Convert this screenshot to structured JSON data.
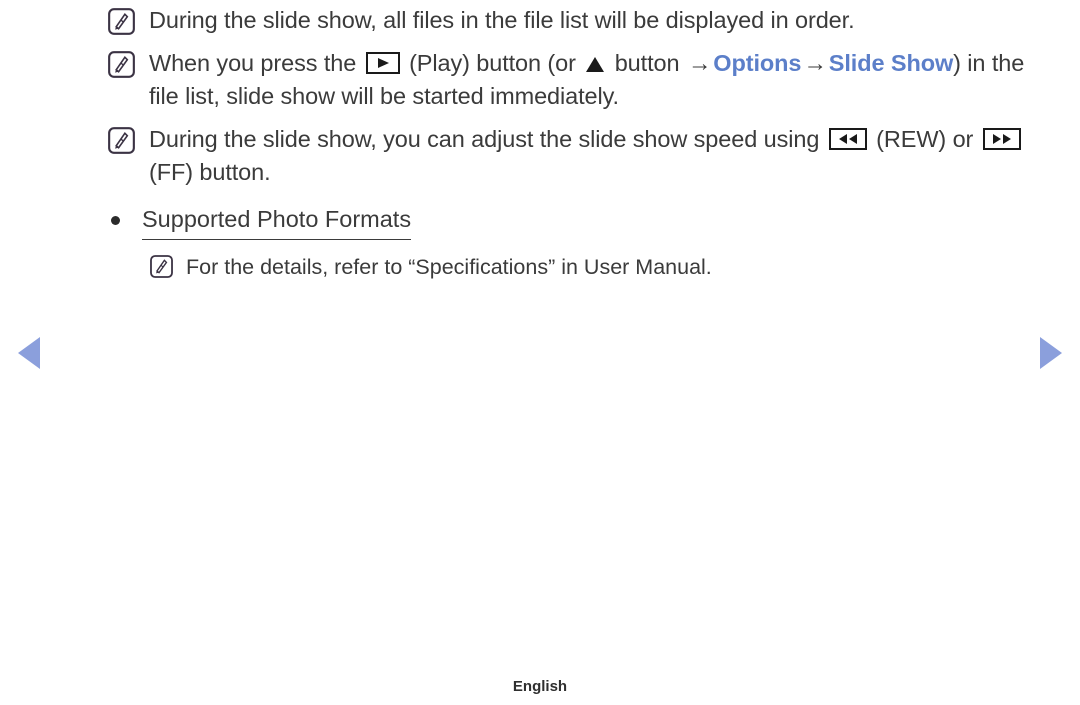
{
  "page": {
    "background": "#ffffff",
    "text_color": "#3b3b3b",
    "accent_color": "#5c7fc9",
    "nav_arrow_color": "#8b9fdc"
  },
  "notes": [
    {
      "icon": "note-icon",
      "text": "During the slide show, all files in the file list will be displayed in order."
    }
  ],
  "note2": {
    "icon": "note-icon",
    "part1": "When you press the ",
    "play_key": "play-button-icon",
    "part2": " (Play) button (or ",
    "up_key": "up-arrow-icon",
    "part3": " button ",
    "arrow1": "→",
    "link1": "Options",
    "arrow2": "→",
    "link2": "Slide Show",
    "part4": ") in the file list, slide show will be started immediately."
  },
  "note3": {
    "icon": "note-icon",
    "part1": "During the slide show, you can adjust the slide show speed using ",
    "rew_key": "rewind-button-icon",
    "part2": " (REW) or ",
    "ff_key": "fast-forward-button-icon",
    "part3": " (FF) button."
  },
  "section": {
    "bullet": "●",
    "heading": "Supported Photo Formats"
  },
  "subnote": {
    "icon": "note-icon",
    "text": "For the details, refer to “Specifications” in User Manual."
  },
  "nav": {
    "prev_label": "previous-page",
    "next_label": "next-page"
  },
  "footer": {
    "language": "English"
  }
}
